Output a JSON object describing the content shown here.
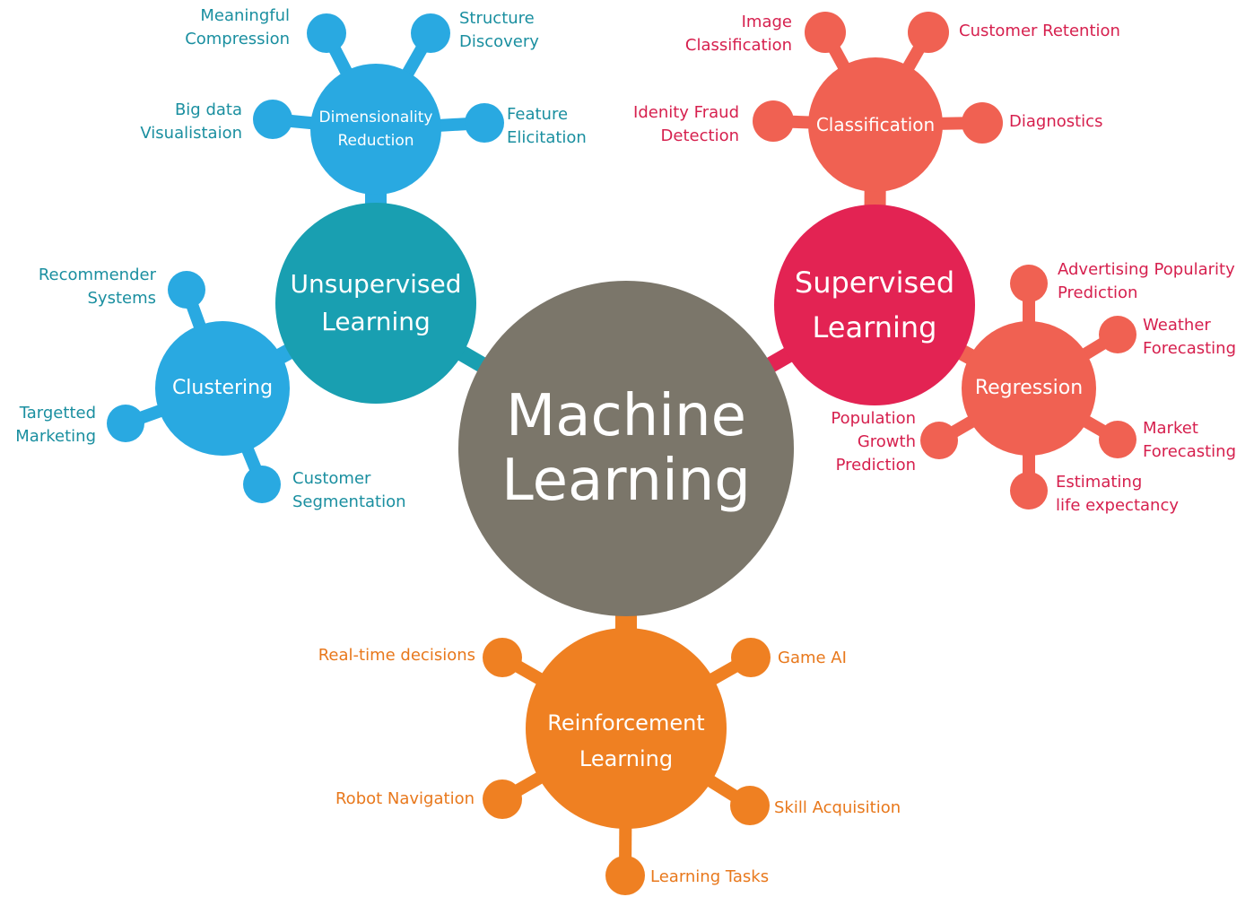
{
  "colors": {
    "center": "#7b766a",
    "unsupervised": "#199fb1",
    "unsupervised_sub": "#29a9e1",
    "unsupervised_text": "#1a8fa0",
    "supervised": "#e32353",
    "supervised_sub": "#f06152",
    "supervised_text": "#d6204e",
    "reinforcement": "#ef8022",
    "reinforcement_text": "#e8781c"
  },
  "center": {
    "label": "Machine\nLearning"
  },
  "unsupervised": {
    "label": "Unsupervised\nLearning",
    "dimensionality": {
      "label": "Dimensionality\nReduction",
      "leaves": [
        "Meaningful\nCompression",
        "Structure\nDiscovery",
        "Big data\nVisualistaion",
        "Feature\nElicitation"
      ]
    },
    "clustering": {
      "label": "Clustering",
      "leaves": [
        "Recommender\nSystems",
        "Targetted\nMarketing",
        "Customer\nSegmentation"
      ]
    }
  },
  "supervised": {
    "label": "Supervised\nLearning",
    "classification": {
      "label": "Classification",
      "leaves": [
        "Image\nClassification",
        "Customer Retention",
        "Idenity Fraud\nDetection",
        "Diagnostics"
      ]
    },
    "regression": {
      "label": "Regression",
      "leaves": [
        "Advertising Popularity\nPrediction",
        "Weather\nForecasting",
        "Population\nGrowth\nPrediction",
        "Market\nForecasting",
        "Estimating\nlife expectancy"
      ]
    }
  },
  "reinforcement": {
    "label": "Reinforcement\nLearning",
    "leaves": [
      "Real-time decisions",
      "Game AI",
      "Robot Navigation",
      "Skill Acquisition",
      "Learning Tasks"
    ]
  }
}
